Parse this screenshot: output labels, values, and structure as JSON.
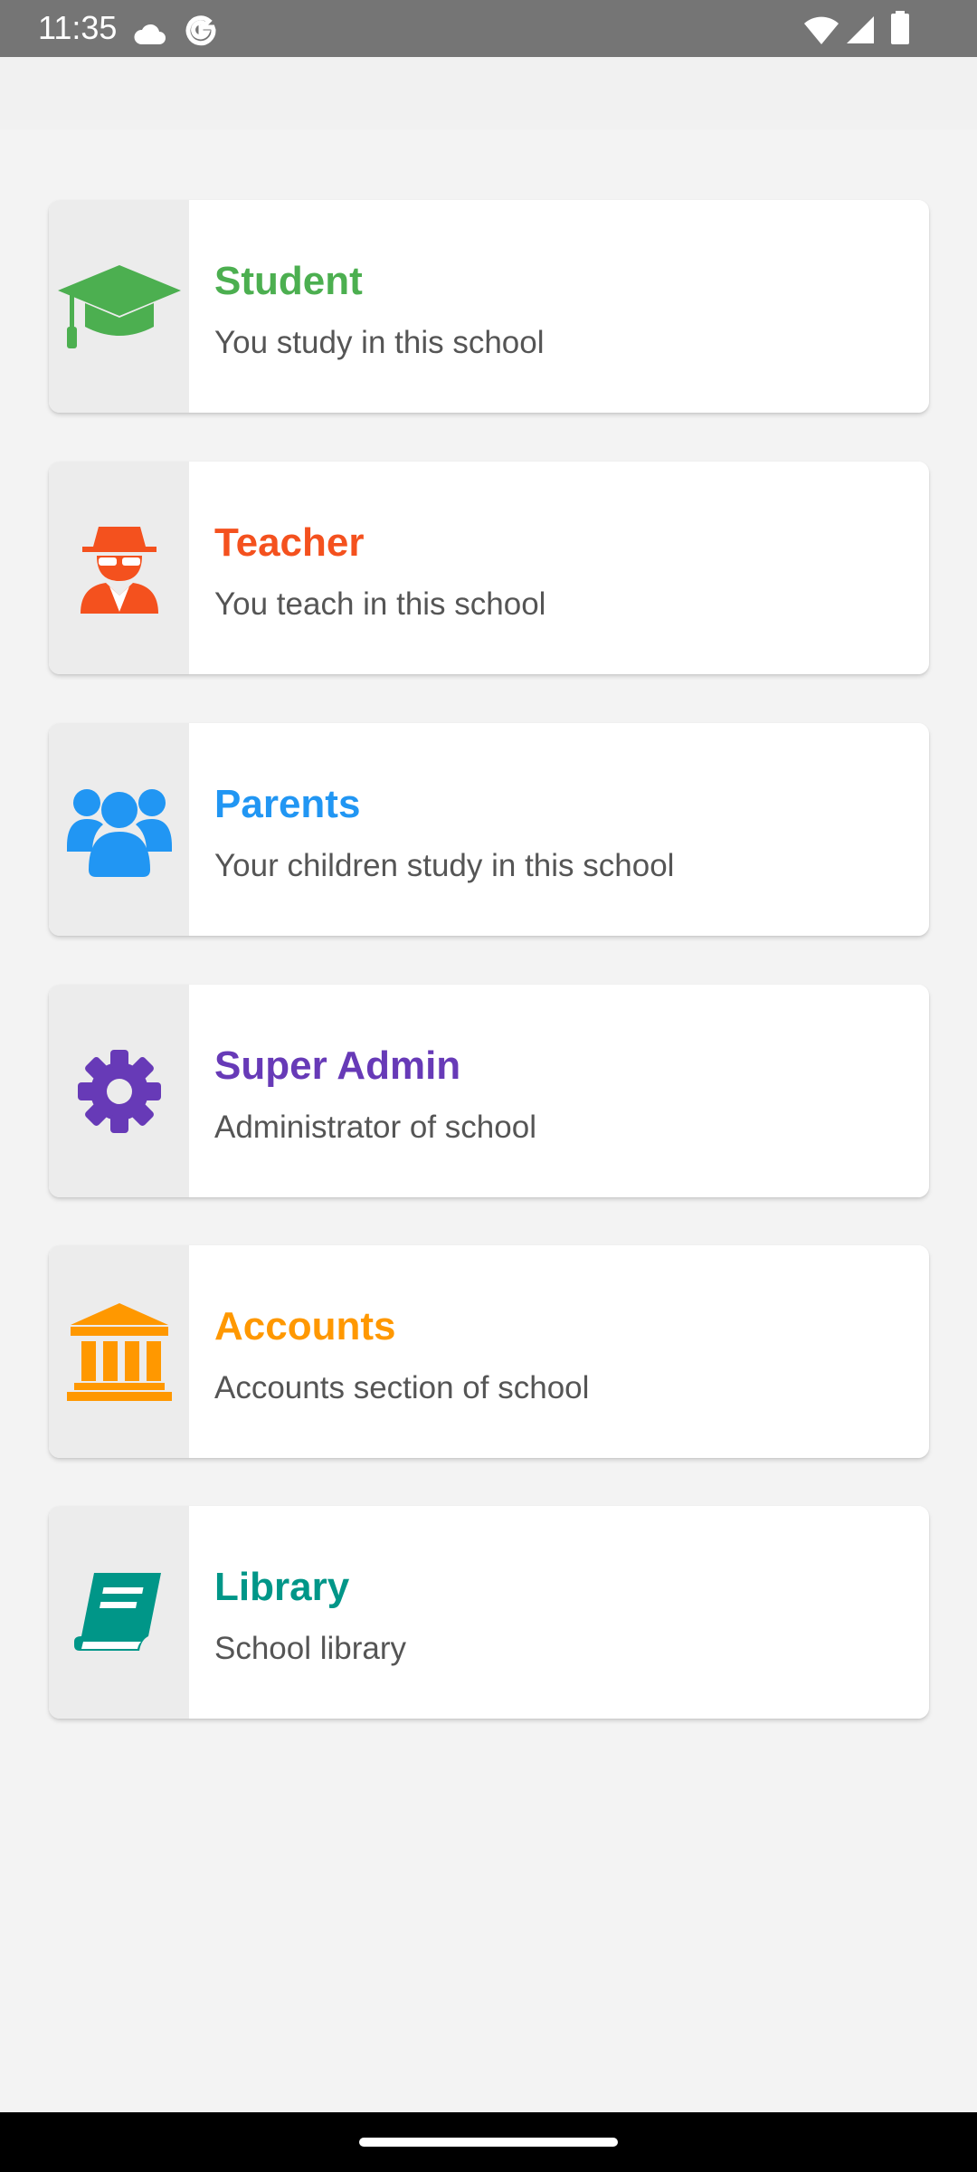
{
  "status_bar": {
    "time": "11:35",
    "icons": [
      "cloud-icon",
      "google-icon",
      "wifi-icon",
      "signal-icon",
      "battery-icon"
    ]
  },
  "roles": [
    {
      "title": "Student",
      "subtitle": "You study in this school",
      "icon": "graduation-cap-icon",
      "color": "#4caf50"
    },
    {
      "title": "Teacher",
      "subtitle": "You teach in this school",
      "icon": "teacher-spy-icon",
      "color": "#f4511e"
    },
    {
      "title": "Parents",
      "subtitle": "Your children study in this school",
      "icon": "users-group-icon",
      "color": "#2196f3"
    },
    {
      "title": "Super Admin",
      "subtitle": "Administrator of school",
      "icon": "gear-icon",
      "color": "#673ab7"
    },
    {
      "title": "Accounts",
      "subtitle": "Accounts section of school",
      "icon": "bank-icon",
      "color": "#ff9800"
    },
    {
      "title": "Library",
      "subtitle": "School library",
      "icon": "book-icon",
      "color": "#009688"
    }
  ]
}
